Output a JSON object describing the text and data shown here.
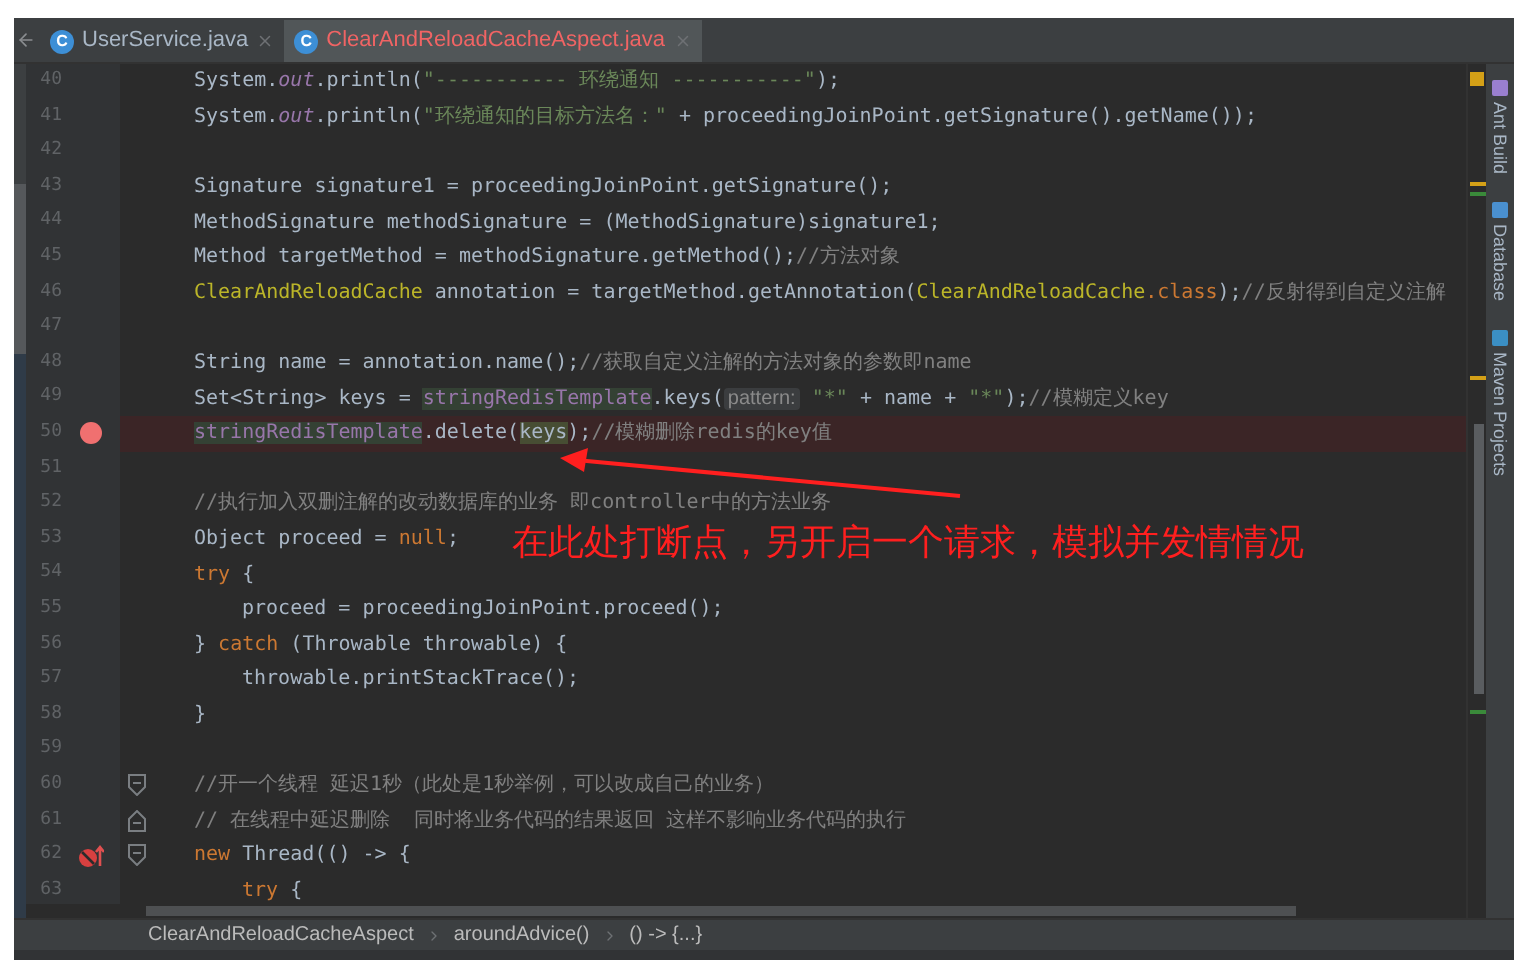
{
  "tabs": [
    {
      "icon_letter": "C",
      "label": "UserService.java",
      "selected": false
    },
    {
      "icon_letter": "C",
      "label": "ClearAndReloadCacheAspect.java",
      "selected": true
    }
  ],
  "lines": [
    {
      "number": "40",
      "tokens": [
        {
          "text": "System.",
          "kind": "plain"
        },
        {
          "text": "out",
          "kind": "field"
        },
        {
          "text": ".println(",
          "kind": "plain"
        },
        {
          "text": "\"----------- 环绕通知 -----------\"",
          "kind": "string"
        },
        {
          "text": ");",
          "kind": "plain"
        }
      ]
    },
    {
      "number": "41",
      "tokens": [
        {
          "text": "System.",
          "kind": "plain"
        },
        {
          "text": "out",
          "kind": "field"
        },
        {
          "text": ".println(",
          "kind": "plain"
        },
        {
          "text": "\"环绕通知的目标方法名：\"",
          "kind": "string"
        },
        {
          "text": " + proceedingJoinPoint.getSignature().getName());",
          "kind": "plain"
        }
      ]
    },
    {
      "number": "42"
    },
    {
      "number": "43",
      "tokens": [
        {
          "text": "Signature signature1 = proceedingJoinPoint.getSignature();",
          "kind": "plain"
        }
      ]
    },
    {
      "number": "44",
      "tokens": [
        {
          "text": "MethodSignature methodSignature = (MethodSignature)signature1;",
          "kind": "plain"
        }
      ]
    },
    {
      "number": "45",
      "tokens": [
        {
          "text": "Method targetMethod = methodSignature.getMethod();",
          "kind": "plain"
        },
        {
          "text": "//方法对象",
          "kind": "comment"
        }
      ]
    },
    {
      "number": "46",
      "tokens": [
        {
          "text": "ClearAndReloadCache",
          "kind": "class"
        },
        {
          "text": " annotation = targetMethod.getAnnotation(",
          "kind": "plain"
        },
        {
          "text": "ClearAndReloadCache",
          "kind": "class"
        },
        {
          "text": ".class",
          "kind": "keyword"
        },
        {
          "text": ");",
          "kind": "plain"
        },
        {
          "text": "//反射得到自定义注解",
          "kind": "comment"
        }
      ]
    },
    {
      "number": "47"
    },
    {
      "number": "48",
      "tokens": [
        {
          "text": "String name = annotation.name();",
          "kind": "plain"
        },
        {
          "text": "//获取自定义注解的方法对象的参数即name",
          "kind": "comment"
        }
      ]
    },
    {
      "number": "49",
      "tokens": [
        {
          "text": "Set<String> keys = ",
          "kind": "plain"
        },
        {
          "text": "stringRedisTemplate",
          "kind": "usage"
        },
        {
          "text": ".keys(",
          "kind": "plain"
        },
        {
          "text": "pattern:",
          "kind": "hint"
        },
        {
          "text": " \"*\"",
          "kind": "string"
        },
        {
          "text": " + name + ",
          "kind": "plain"
        },
        {
          "text": "\"*\"",
          "kind": "string"
        },
        {
          "text": ");",
          "kind": "plain"
        },
        {
          "text": "//模糊定义key",
          "kind": "comment"
        }
      ]
    },
    {
      "number": "50",
      "gutter_icon": {
        "kind": "breakpoint"
      },
      "tokens": [
        {
          "text": "stringRedisTemplate",
          "kind": "usage"
        },
        {
          "text": ".delete(",
          "kind": "plain"
        },
        {
          "text": "keys",
          "kind": "usage_write"
        },
        {
          "text": ");",
          "kind": "plain"
        },
        {
          "text": "//模糊删除redis的key值",
          "kind": "comment"
        }
      ]
    },
    {
      "number": "51"
    },
    {
      "number": "52",
      "tokens": [
        {
          "text": "//执行加入双删注解的改动数据库的业务 即controller中的方法业务",
          "kind": "comment"
        }
      ]
    },
    {
      "number": "53",
      "tokens": [
        {
          "text": "Object proceed = ",
          "kind": "plain"
        },
        {
          "text": "null",
          "kind": "keyword"
        },
        {
          "text": ";",
          "kind": "plain"
        }
      ]
    },
    {
      "number": "54",
      "tokens": [
        {
          "text": "try",
          "kind": "keyword"
        },
        {
          "text": " {",
          "kind": "plain"
        }
      ],
      "children": [
        {
          "number": "55",
          "tokens": [
            {
              "text": "proceed = proceedingJoinPoint.proceed();",
              "kind": "plain"
            }
          ]
        }
      ]
    },
    {
      "number": "56",
      "tokens": [
        {
          "text": "} ",
          "kind": "plain"
        },
        {
          "text": "catch",
          "kind": "keyword"
        },
        {
          "text": " (Throwable throwable) {",
          "kind": "plain"
        }
      ],
      "children": [
        {
          "number": "57",
          "tokens": [
            {
              "text": "throwable.printStackTrace();",
              "kind": "plain"
            }
          ]
        }
      ]
    },
    {
      "number": "58",
      "tokens": [
        {
          "text": "}",
          "kind": "plain"
        }
      ]
    },
    {
      "number": "59"
    },
    {
      "number": "60",
      "fold_icon": {
        "kind": "start"
      },
      "tokens": [
        {
          "text": "//开一个线程 延迟1秒（此处是1秒举例，可以改成自己的业务）",
          "kind": "comment"
        }
      ]
    },
    {
      "number": "61",
      "fold_icon": {
        "kind": "end"
      },
      "tokens": [
        {
          "text": "// 在线程中延迟删除  同时将业务代码的结果返回 这样不影响业务代码的执行",
          "kind": "comment"
        }
      ]
    },
    {
      "number": "62",
      "gutter_icon": {
        "kind": "lambda"
      },
      "fold_icon": {
        "kind": "start"
      },
      "tokens": [
        {
          "text": "new",
          "kind": "keyword"
        },
        {
          "text": " Thread(() -> {",
          "kind": "plain"
        }
      ],
      "children": [
        {
          "number": "63",
          "tokens": [
            {
              "text": "try",
              "kind": "keyword"
            },
            {
              "text": " {",
              "kind": "plain"
            }
          ]
        }
      ]
    }
  ],
  "annotation": {
    "text": "在此处打断点，另开启一个请求，模拟并发情情况"
  },
  "tool_windows": [
    {
      "label": "Ant Build",
      "kind": "ant"
    },
    {
      "label": "Database",
      "kind": "database"
    },
    {
      "label": "Maven Projects",
      "kind": "maven"
    }
  ],
  "breadcrumbs": [
    "ClearAndReloadCacheAspect",
    "aroundAdvice()",
    "() -> {...}"
  ]
}
